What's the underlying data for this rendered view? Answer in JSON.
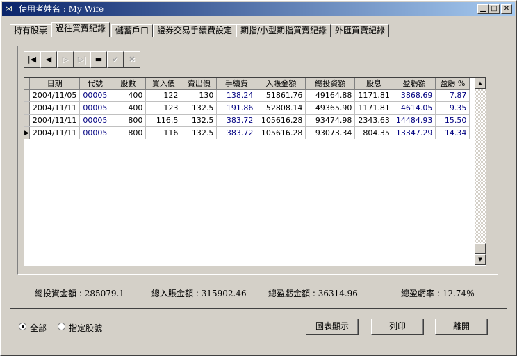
{
  "window": {
    "title": "使用者姓名 : My Wife",
    "icon": "butterfly-icon"
  },
  "tabs": [
    {
      "label": "持有股票"
    },
    {
      "label": "過往買賣紀錄"
    },
    {
      "label": "儲蓄戶口"
    },
    {
      "label": "證券交易手續費設定"
    },
    {
      "label": "期指/小型期指買賣紀錄"
    },
    {
      "label": "外匯買賣紀錄"
    }
  ],
  "active_tab": "過往買賣紀錄",
  "navigator": {
    "icons": [
      "first-record-icon",
      "prior-record-icon",
      "next-record-icon",
      "last-record-icon",
      "delete-record-icon",
      "post-edit-icon",
      "cancel-edit-icon"
    ]
  },
  "grid": {
    "columns": [
      "日期",
      "代號",
      "股數",
      "買入價",
      "賣出價",
      "手續費",
      "入賬金額",
      "總投資額",
      "股息",
      "盈虧額",
      "盈虧 %"
    ],
    "rows": [
      [
        "2004/11/05",
        "00005",
        "400",
        "122",
        "130",
        "138.24",
        "51861.76",
        "49164.88",
        "1171.81",
        "3868.69",
        "7.87"
      ],
      [
        "2004/11/11",
        "00005",
        "400",
        "123",
        "132.5",
        "191.86",
        "52808.14",
        "49365.90",
        "1171.81",
        "4614.05",
        "9.35"
      ],
      [
        "2004/11/11",
        "00005",
        "800",
        "116.5",
        "132.5",
        "383.72",
        "105616.28",
        "93474.98",
        "2343.63",
        "14484.93",
        "15.50"
      ],
      [
        "2004/11/11",
        "00005",
        "800",
        "116",
        "132.5",
        "383.72",
        "105616.28",
        "93073.34",
        "804.35",
        "13347.29",
        "14.34"
      ]
    ],
    "current_row": 3
  },
  "summary": {
    "total_invest_label": "總投資金額 :",
    "total_invest_value": "285079.1",
    "total_income_label": "總入賬金額 :",
    "total_income_value": "315902.46",
    "total_pl_label": "總盈虧金額 :",
    "total_pl_value": "36314.96",
    "pl_rate_label": "總盈虧率 :",
    "pl_rate_value": "12.74％"
  },
  "filter": {
    "all_label": "全部",
    "specific_label": "指定股號",
    "selected": "全部"
  },
  "buttons": {
    "chart": "圖表顯示",
    "print": "列印",
    "close": "離開"
  }
}
